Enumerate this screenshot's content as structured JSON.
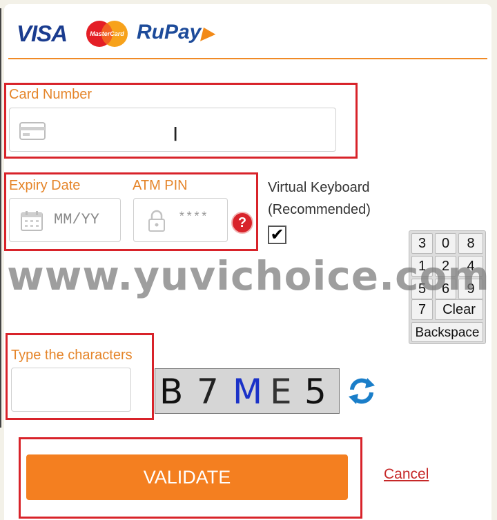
{
  "brands": {
    "visa": "VISA",
    "mastercard": "MasterCard",
    "rupay": "RuPay"
  },
  "card_number": {
    "label": "Card Number",
    "value": ""
  },
  "expiry": {
    "label": "Expiry Date",
    "placeholder": "MM/YY"
  },
  "atm_pin": {
    "label": "ATM PIN",
    "placeholder": "****",
    "help": "?"
  },
  "virtual_keyboard": {
    "label_line1": "Virtual Keyboard",
    "label_line2": "(Recommended)",
    "checked": true,
    "check_glyph": "✔"
  },
  "keypad": {
    "keys": [
      "3",
      "0",
      "8",
      "1",
      "2",
      "4",
      "5",
      "6",
      "9",
      "7",
      "Clear",
      "Backspace"
    ]
  },
  "watermark": "www.yuvichoice.com",
  "captcha": {
    "label": "Type the characters",
    "characters": [
      {
        "char": "B",
        "color": "#111111"
      },
      {
        "char": "7",
        "color": "#222222"
      },
      {
        "char": "M",
        "color": "#1b32c8"
      },
      {
        "char": "E",
        "color": "#333333"
      },
      {
        "char": "5",
        "color": "#111111"
      }
    ]
  },
  "actions": {
    "validate": "VALIDATE",
    "cancel": "Cancel"
  },
  "colors": {
    "accent_orange": "#f47f20",
    "label_orange": "#e5852a",
    "highlight_red": "#d8232a",
    "link_red": "#c62828"
  }
}
